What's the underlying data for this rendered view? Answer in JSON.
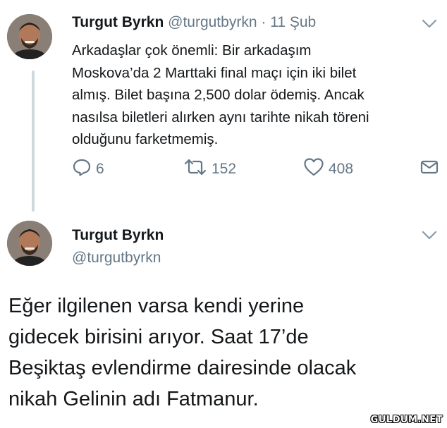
{
  "tweet1": {
    "name": "Turgut Byrkn",
    "handle": "@turgutbyrkn",
    "separator": "·",
    "date": "11 Şub",
    "text_lines": [
      "Arkadaşlar çok önemli: Bir arkadaşım",
      "Moskova’da 2 Marttaki final maçı için iki bilet",
      "almış. Bilet başına 2,500 dolar ödemiş. Ancak",
      "nasılsa biletleri alırken aynı tarihte nikah töreni",
      "olduğunu farketmemiş."
    ],
    "replies": "6",
    "retweets": "152",
    "likes": "408"
  },
  "tweet2": {
    "name": "Turgut Byrkn",
    "handle": "@turgutbyrkn",
    "text_lines": [
      "Eğer ilgilenen varsa kendi yerine",
      "gidecek birisini arıyor. Saat 17’de",
      "Beşiktaş evlendirme dairesinde olacak",
      "nikah Gelinin adı Fatmanur."
    ]
  },
  "watermark": "GULDUM.NET",
  "icons": {
    "reply": "reply-icon",
    "retweet": "retweet-icon",
    "like": "heart-icon",
    "dm": "envelope-icon",
    "menu": "chevron-down-icon"
  },
  "colors": {
    "text": "#14171a",
    "secondary": "#657786",
    "thread_line": "#cfd8de"
  }
}
